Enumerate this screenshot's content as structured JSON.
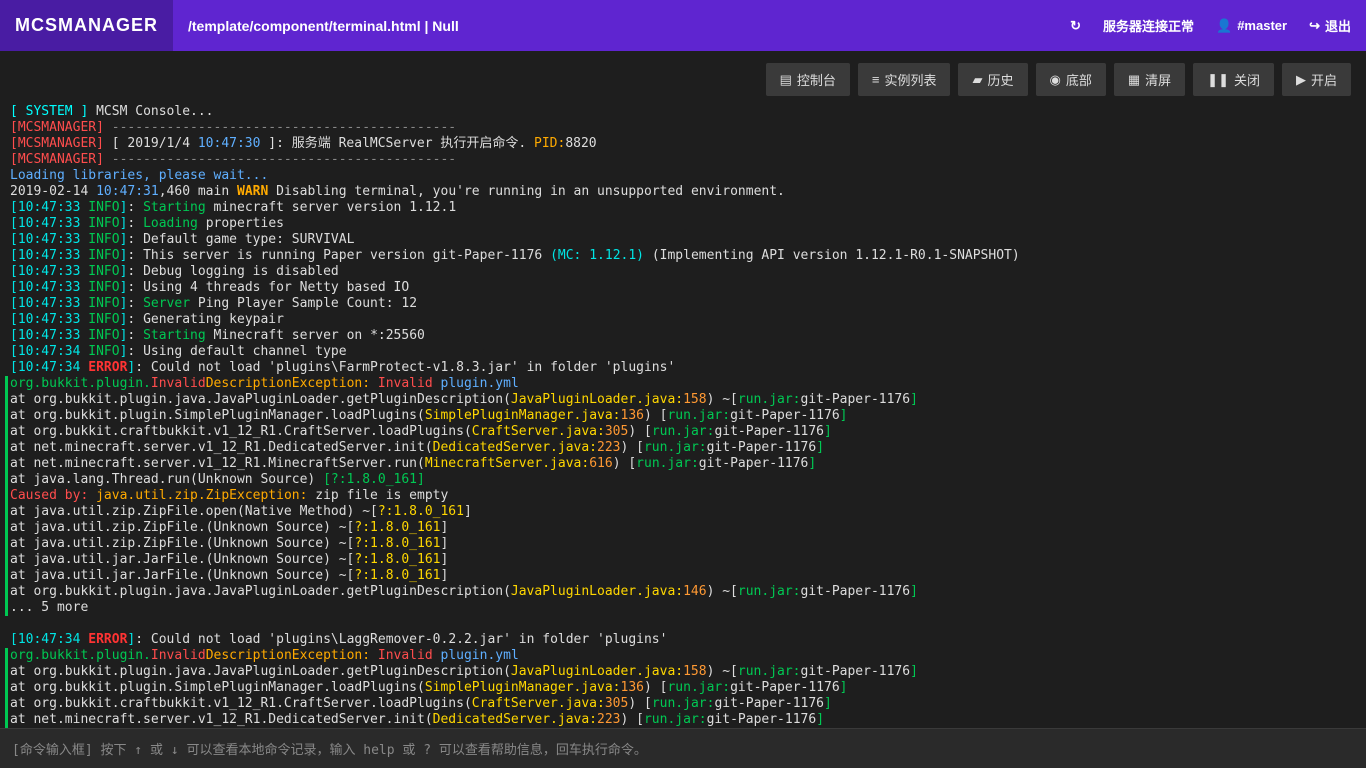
{
  "header": {
    "logo": "MCSMANAGER",
    "breadcrumb": "/template/component/terminal.html | Null",
    "status": "服务器连接正常",
    "user": "#master",
    "logout": "退出"
  },
  "toolbar": {
    "console": "控制台",
    "instances": "实例列表",
    "history": "历史",
    "bottom": "底部",
    "clear": "清屏",
    "close": "关闭",
    "open": "开启"
  },
  "input": {
    "placeholder": "[命令输入框] 按下 ↑ 或 ↓ 可以查看本地命令记录，输入 help 或 ? 可以查看帮助信息，回车执行命令。"
  },
  "console": {
    "sys_label": "[ SYSTEM ]",
    "sys_msg": " MCSM Console...",
    "mgr_label": "[MCSMANAGER]",
    "dashes": " --------------------------------------------",
    "date": "[ 2019/1/4 ",
    "time1": "10:47:30",
    "msg1": " ]: 服务端 RealMCServer 执行开启命令. ",
    "pid_label": "PID:",
    "pid_val": "8820",
    "loading": "Loading libraries, please wait...",
    "date2": "2019-02-14 ",
    "time2": "10:47:31",
    "warn_ms": ",460 main ",
    "warn_label": "WARN",
    "warn_msg": " Disabling terminal, you're running in an unsupported environment.",
    "info_lines": [
      {
        "t": "10:47:33",
        "action": "Starting",
        "msg": " minecraft server version 1.12.1"
      },
      {
        "t": "10:47:33",
        "action": "Loading",
        "msg": " properties"
      },
      {
        "t": "10:47:33",
        "action": "",
        "msg": "Default game type: SURVIVAL"
      },
      {
        "t": "10:47:33",
        "action": "",
        "msg": "This server is running Paper version git-Paper-1176 ",
        "extra": "(MC: 1.12.1)",
        "extra2": " (Implementing API version 1.12.1-R0.1-SNAPSHOT)"
      },
      {
        "t": "10:47:33",
        "action": "",
        "msg": "Debug logging is disabled"
      },
      {
        "t": "10:47:33",
        "action": "",
        "msg": "Using 4 threads for Netty based IO"
      },
      {
        "t": "10:47:33",
        "action": "Server",
        "msg": " Ping Player Sample Count: 12"
      },
      {
        "t": "10:47:33",
        "action": "",
        "msg": "Generating keypair"
      },
      {
        "t": "10:47:33",
        "action": "Starting",
        "msg": " Minecraft server on *:25560"
      },
      {
        "t": "10:47:34",
        "action": "",
        "msg": "Using default channel type"
      }
    ],
    "err1": {
      "t": "10:47:34",
      "msg": ": Could not load 'plugins\\FarmProtect-v1.8.3.jar' in folder 'plugins'"
    },
    "excp1": "org.bukkit.plugin.",
    "excp2": "Invalid",
    "excp3": "DescriptionException: ",
    "excp4": "Invalid",
    "excp5": " plugin.yml",
    "stack": [
      {
        "pre": "at org.bukkit.plugin.java.JavaPluginLoader.getPluginDescription(",
        "cls": "JavaPluginLoader.java:",
        "ln": "158",
        "post": ") ~[",
        "jar": "run.jar:",
        "ver": "git-Paper-1176",
        "end": "]"
      },
      {
        "pre": "at org.bukkit.plugin.SimplePluginManager.loadPlugins(",
        "cls": "SimplePluginManager.java:",
        "ln": "136",
        "post": ") [",
        "jar": "run.jar:",
        "ver": "git-Paper-1176",
        "end": "]"
      },
      {
        "pre": "at org.bukkit.craftbukkit.v1_12_R1.CraftServer.loadPlugins(",
        "cls": "CraftServer.java:",
        "ln": "305",
        "post": ") [",
        "jar": "run.jar:",
        "ver": "git-Paper-1176",
        "end": "]"
      },
      {
        "pre": "at net.minecraft.server.v1_12_R1.DedicatedServer.init(",
        "cls": "DedicatedServer.java:",
        "ln": "223",
        "post": ") [",
        "jar": "run.jar:",
        "ver": "git-Paper-1176",
        "end": "]"
      },
      {
        "pre": "at net.minecraft.server.v1_12_R1.MinecraftServer.run(",
        "cls": "MinecraftServer.java:",
        "ln": "616",
        "post": ") [",
        "jar": "run.jar:",
        "ver": "git-Paper-1176",
        "end": "]"
      }
    ],
    "thread_line": "at java.lang.Thread.run(Unknown Source) ",
    "thread_ver": "[?:1.8.0_161]",
    "caused1": "Caused by:",
    "caused2": " java.util.zip.ZipException:",
    "caused3": " zip file is empty",
    "zip_stack": [
      "at java.util.zip.ZipFile.open(Native Method) ~[",
      "at java.util.zip.ZipFile.<init>(Unknown Source) ~[",
      "at java.util.zip.ZipFile.<init>(Unknown Source) ~[",
      "at java.util.jar.JarFile.<init>(Unknown Source) ~[",
      "at java.util.jar.JarFile.<init>(Unknown Source) ~["
    ],
    "zip_ver": "?:1.8.0_161",
    "stack2_pre": "at org.bukkit.plugin.java.JavaPluginLoader.getPluginDescription(",
    "stack2_cls": "JavaPluginLoader.java:",
    "stack2_ln": "146",
    "more": "... 5 more",
    "err2": {
      "t": "10:47:34",
      "msg": ": Could not load 'plugins\\LaggRemover-0.2.2.jar' in folder 'plugins'"
    }
  }
}
